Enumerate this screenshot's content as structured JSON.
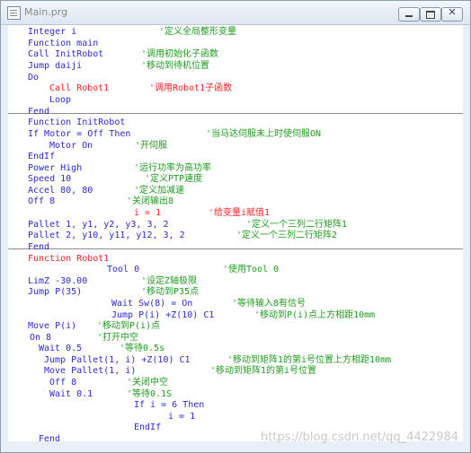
{
  "window": {
    "title": "Main.prg",
    "icon": "document-icon",
    "controls": [
      "minimize-icon",
      "maximize-icon",
      "close-icon"
    ]
  },
  "watermark": "https://blog.csdn.net/qq_4422984",
  "code_lines": [
    {
      "tokens": [
        [
          "kw",
          "Integer i"
        ],
        [
          "cmt",
          "'定义全局整形变量"
        ]
      ],
      "section": 1
    },
    {
      "tokens": [
        [
          "kw",
          "Function main"
        ]
      ],
      "section": 1
    },
    {
      "tokens": [
        [
          "kw",
          "Call InitRobot"
        ],
        [
          "cmt",
          "'调用初始化子函数"
        ]
      ],
      "section": 1
    },
    {
      "tokens": [
        [
          "kw",
          "Jump daiji"
        ],
        [
          "cmt",
          "'移动到待机位置"
        ]
      ],
      "section": 1
    },
    {
      "tokens": [
        [
          "kw",
          "Do"
        ]
      ],
      "section": 1
    },
    {
      "tokens": [
        [
          "red",
          "Call Robot1"
        ],
        [
          "red",
          "'调用Robot1子函数"
        ]
      ],
      "section": 1
    },
    {
      "tokens": [
        [
          "kw",
          "Loop"
        ]
      ],
      "section": 1
    },
    {
      "tokens": [
        [
          "kw",
          "Fend"
        ]
      ],
      "section": 1
    },
    {
      "tokens": [
        [
          "kw",
          "Function InitRobot"
        ]
      ],
      "section": 2
    },
    {
      "tokens": [
        [
          "kw",
          "If Motor = Off Then"
        ],
        [
          "cmt",
          "'当马达伺服未上时使伺服ON"
        ]
      ],
      "section": 2
    },
    {
      "tokens": [
        [
          "kw",
          "Motor On"
        ],
        [
          "cmt",
          "'开伺服"
        ]
      ],
      "section": 2
    },
    {
      "tokens": [
        [
          "kw",
          "EndIf"
        ]
      ],
      "section": 2
    },
    {
      "tokens": [
        [
          "kw",
          "Power High"
        ],
        [
          "cmt",
          "'运行功率为高功率"
        ]
      ],
      "section": 2
    },
    {
      "tokens": [
        [
          "kw",
          "Speed 10"
        ],
        [
          "cmt",
          "'定义PTP速度"
        ]
      ],
      "section": 2
    },
    {
      "tokens": [
        [
          "kw",
          "Accel 80, 80"
        ],
        [
          "cmt",
          "'定义加减速"
        ]
      ],
      "section": 2
    },
    {
      "tokens": [
        [
          "kw",
          "Off 8"
        ],
        [
          "cmt",
          "'关闭输出8"
        ]
      ],
      "section": 2
    },
    {
      "tokens": [
        [
          "red",
          "i = 1"
        ],
        [
          "red",
          "'给变量i赋值1"
        ]
      ],
      "section": 2
    },
    {
      "tokens": [
        [
          "kw",
          "Pallet 1, y1, y2, y3, 3, 2"
        ],
        [
          "cmt",
          "'定义一个三列二行矩阵1"
        ]
      ],
      "section": 2
    },
    {
      "tokens": [
        [
          "kw",
          "Pallet 2, y10, y11, y12, 3, 2"
        ],
        [
          "cmt",
          "'定义一个三列二行矩阵2"
        ]
      ],
      "section": 2
    },
    {
      "tokens": [
        [
          "kw",
          "Fend"
        ]
      ],
      "section": 2
    },
    {
      "tokens": [
        [
          "red",
          "Function Robot1"
        ]
      ],
      "section": 3
    },
    {
      "tokens": [
        [
          "kw",
          "Tool 0"
        ],
        [
          "cmt",
          "'使用Tool 0"
        ]
      ],
      "section": 3
    },
    {
      "tokens": [
        [
          "kw",
          "LimZ -30.00"
        ],
        [
          "cmt",
          "'设定Z轴极限"
        ]
      ],
      "section": 3
    },
    {
      "tokens": [
        [
          "kw",
          "Jump P(35)"
        ],
        [
          "cmt",
          "'移动到P35点"
        ]
      ],
      "section": 3
    },
    {
      "tokens": [
        [
          "kw",
          "Wait Sw(8) = On"
        ],
        [
          "cmt",
          "'等待输入8有信号"
        ]
      ],
      "section": 3
    },
    {
      "tokens": [
        [
          "kw",
          "Jump P(i) +Z(10) C1"
        ],
        [
          "cmt",
          "'移动到P(i)点上方相距10mm"
        ]
      ],
      "section": 3
    },
    {
      "tokens": [
        [
          "kw",
          "Move P(i)"
        ],
        [
          "cmt",
          "'移动到P(i)点"
        ]
      ],
      "section": 3
    },
    {
      "tokens": [
        [
          "kw",
          "On 8"
        ],
        [
          "cmt",
          "'打开中空"
        ]
      ],
      "section": 3
    },
    {
      "tokens": [
        [
          "kw",
          "Wait 0.5"
        ],
        [
          "cmt",
          "'等待0.5s"
        ]
      ],
      "section": 3
    },
    {
      "tokens": [
        [
          "kw",
          "Jump Pallet(1, i) +Z(10) C1"
        ],
        [
          "cmt",
          "'移动到矩阵1的第i号位置上方相距10mm"
        ]
      ],
      "section": 3
    },
    {
      "tokens": [
        [
          "kw",
          "Move Pallet(1, i)"
        ],
        [
          "cmt",
          "'移动到矩阵1的第i号位置"
        ]
      ],
      "section": 3
    },
    {
      "tokens": [
        [
          "kw",
          "Off 8"
        ],
        [
          "cmt",
          "'关闭中空"
        ]
      ],
      "section": 3
    },
    {
      "tokens": [
        [
          "kw",
          "Wait 0.1"
        ],
        [
          "cmt",
          "'等待0.1S"
        ]
      ],
      "section": 3
    },
    {
      "tokens": [
        [
          "kw",
          "If i = 6 Then"
        ]
      ],
      "section": 3
    },
    {
      "tokens": [
        [
          "kw",
          "i = 1"
        ]
      ],
      "section": 3
    },
    {
      "tokens": [
        [
          "kw",
          "EndIf"
        ]
      ],
      "section": 3
    },
    {
      "tokens": [
        [
          "kw",
          "Fend"
        ]
      ],
      "section": 3
    }
  ]
}
